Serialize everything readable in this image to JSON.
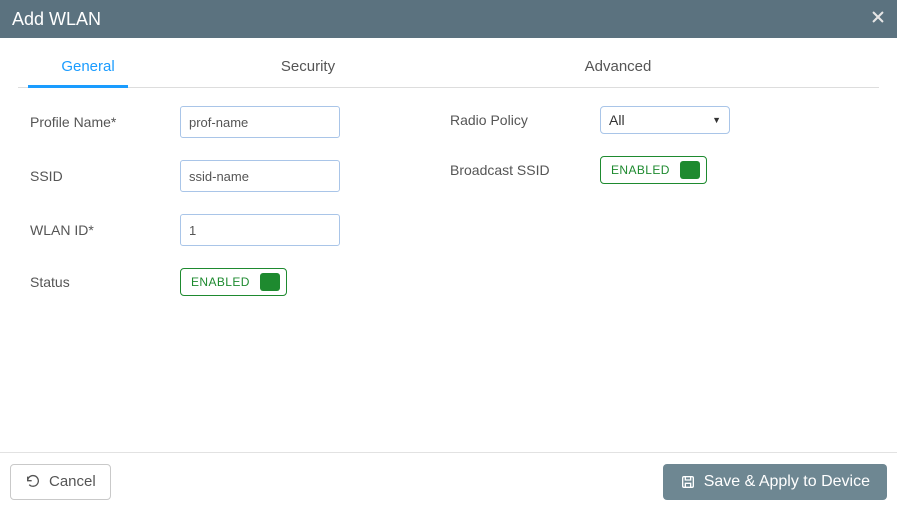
{
  "dialog": {
    "title": "Add WLAN"
  },
  "tabs": {
    "general": "General",
    "security": "Security",
    "advanced": "Advanced"
  },
  "fields": {
    "profile_name_label": "Profile Name*",
    "profile_name_value": "prof-name",
    "ssid_label": "SSID",
    "ssid_value": "ssid-name",
    "wlan_id_label": "WLAN ID*",
    "wlan_id_value": "1",
    "status_label": "Status",
    "status_toggle": "ENABLED",
    "radio_policy_label": "Radio Policy",
    "radio_policy_value": "All",
    "broadcast_ssid_label": "Broadcast SSID",
    "broadcast_ssid_toggle": "ENABLED"
  },
  "footer": {
    "cancel": "Cancel",
    "save": "Save & Apply to Device"
  },
  "colors": {
    "titlebar": "#5b727f",
    "accent": "#1a9cff",
    "toggle_green": "#1e8a2f",
    "primary_btn": "#6e8792"
  }
}
